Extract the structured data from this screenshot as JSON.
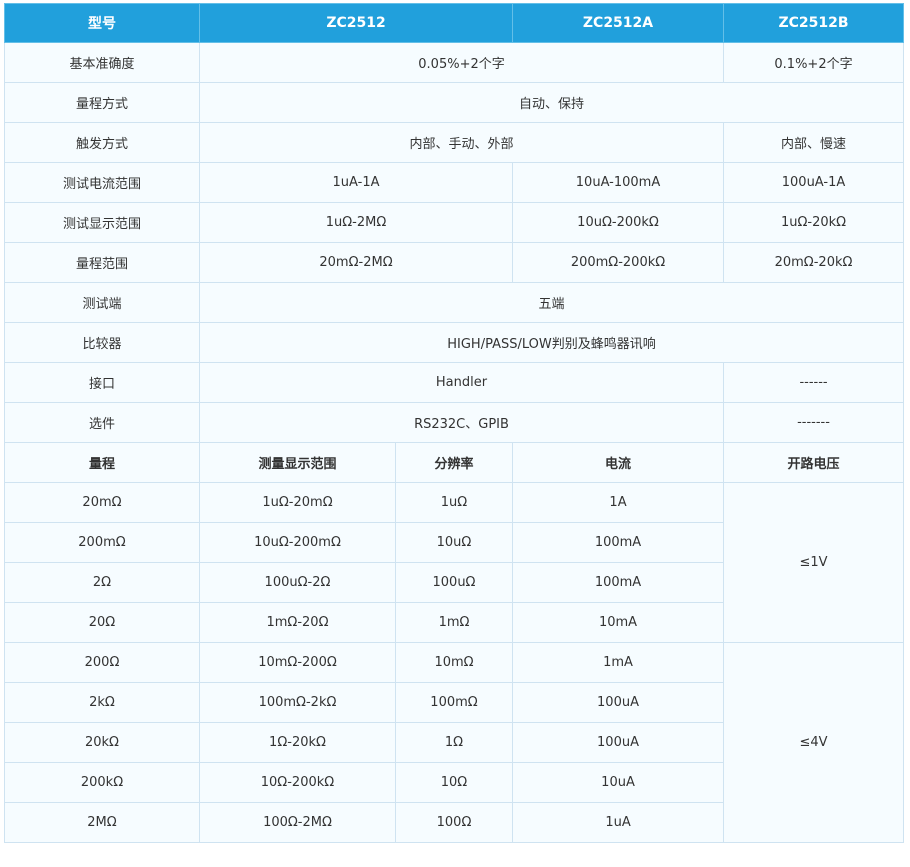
{
  "header": {
    "model": "型号",
    "zc2512": "ZC2512",
    "zc2512a": "ZC2512A",
    "zc2512b": "ZC2512B"
  },
  "specs": {
    "accuracy": {
      "label": "基本准确度",
      "ab": "0.05%+2个字",
      "b": "0.1%+2个字"
    },
    "range_mode": {
      "label": "量程方式",
      "all": "自动、保持"
    },
    "trigger": {
      "label": "触发方式",
      "ab": "内部、手动、外部",
      "b": "内部、慢速"
    },
    "current": {
      "label": "测试电流范围",
      "zc2512": "1uA-1A",
      "zc2512a": "10uA-100mA",
      "zc2512b": "100uA-1A"
    },
    "display": {
      "label": "测试显示范围",
      "zc2512": "1uΩ-2MΩ",
      "zc2512a": "10uΩ-200kΩ",
      "zc2512b": "1uΩ-20kΩ"
    },
    "range": {
      "label": "量程范围",
      "zc2512": "20mΩ-2MΩ",
      "zc2512a": "200mΩ-200kΩ",
      "zc2512b": "20mΩ-20kΩ"
    },
    "terminal": {
      "label": "测试端",
      "all": "五端"
    },
    "comparator": {
      "label": "比较器",
      "all": "HIGH/PASS/LOW判别及蜂鸣器讯响"
    },
    "interface": {
      "label": "接口",
      "ab": "Handler",
      "b": "------"
    },
    "options": {
      "label": "选件",
      "ab": "RS232C、GPIB",
      "b": "-------"
    }
  },
  "range_table": {
    "headers": {
      "range": "量程",
      "display": "测量显示范围",
      "resolution": "分辨率",
      "current": "电流",
      "voltage": "开路电压"
    },
    "rows": [
      {
        "range": "20mΩ",
        "display": "1uΩ-20mΩ",
        "resolution": "1uΩ",
        "current": "1A"
      },
      {
        "range": "200mΩ",
        "display": "10uΩ-200mΩ",
        "resolution": "10uΩ",
        "current": "100mA"
      },
      {
        "range": "2Ω",
        "display": "100uΩ-2Ω",
        "resolution": "100uΩ",
        "current": "100mA"
      },
      {
        "range": "20Ω",
        "display": "1mΩ-20Ω",
        "resolution": "1mΩ",
        "current": "10mA"
      },
      {
        "range": "200Ω",
        "display": "10mΩ-200Ω",
        "resolution": "10mΩ",
        "current": "1mA"
      },
      {
        "range": "2kΩ",
        "display": "100mΩ-2kΩ",
        "resolution": "100mΩ",
        "current": "100uA"
      },
      {
        "range": "20kΩ",
        "display": "1Ω-20kΩ",
        "resolution": "1Ω",
        "current": "100uA"
      },
      {
        "range": "200kΩ",
        "display": "10Ω-200kΩ",
        "resolution": "10Ω",
        "current": "10uA"
      },
      {
        "range": "2MΩ",
        "display": "100Ω-2MΩ",
        "resolution": "100Ω",
        "current": "1uA"
      }
    ],
    "voltage_groups": [
      "≤1V",
      "≤4V"
    ]
  }
}
